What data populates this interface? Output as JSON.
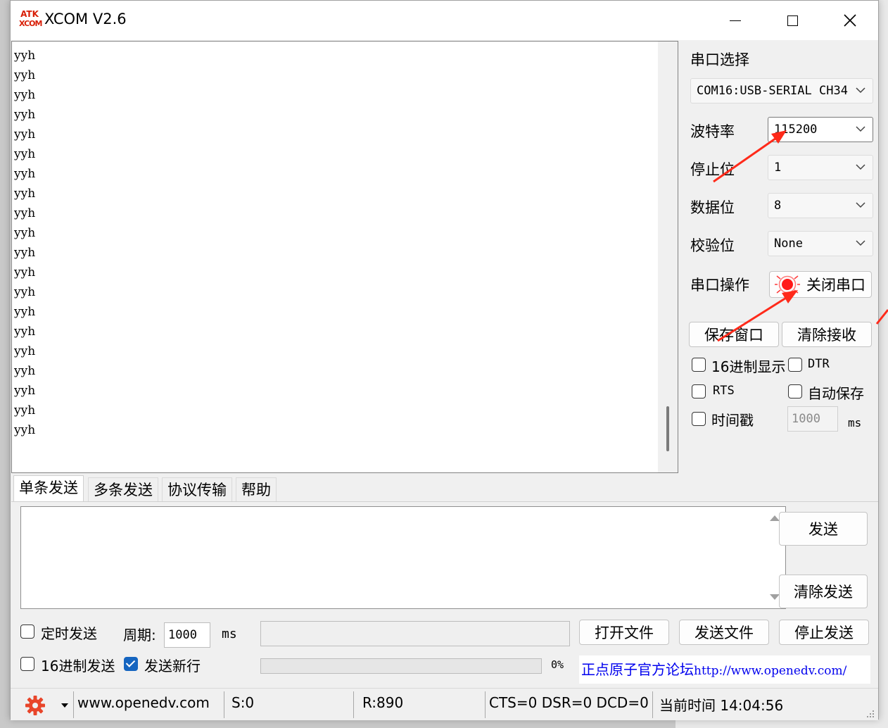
{
  "window": {
    "title": "XCOM V2.6",
    "icon_text": [
      "ATK",
      "XCOM"
    ]
  },
  "receive": {
    "lines": [
      "yyh",
      "yyh",
      "yyh",
      "yyh",
      "yyh",
      "yyh",
      "yyh",
      "yyh",
      "yyh",
      "yyh",
      "yyh",
      "yyh",
      "yyh",
      "yyh",
      "yyh",
      "yyh",
      "yyh",
      "yyh",
      "yyh",
      "yyh"
    ]
  },
  "serial": {
    "port_label": "串口选择",
    "port_value": "COM16:USB-SERIAL CH34",
    "baud_label": "波特率",
    "baud_value": "115200",
    "stop_label": "停止位",
    "stop_value": "1",
    "data_label": "数据位",
    "data_value": "8",
    "parity_label": "校验位",
    "parity_value": "None",
    "op_label": "串口操作",
    "op_button": "关闭串口",
    "save_window": "保存窗口",
    "clear_receive": "清除接收"
  },
  "options": {
    "hex_display": "16进制显示",
    "dtr": "DTR",
    "rts": "RTS",
    "auto_save": "自动保存",
    "timestamp": "时间戳",
    "timestamp_value": "1000",
    "timestamp_unit": "ms"
  },
  "tabs": [
    {
      "label": "单条发送",
      "active": true
    },
    {
      "label": "多条发送",
      "active": false
    },
    {
      "label": "协议传输",
      "active": false
    },
    {
      "label": "帮助",
      "active": false
    }
  ],
  "send": {
    "text": "",
    "send_button": "发送",
    "clear_send_button": "清除发送",
    "timed_send": "定时发送",
    "period_label": "周期:",
    "period_value": "1000",
    "period_unit": "ms",
    "open_file": "打开文件",
    "send_file": "发送文件",
    "stop_send": "停止发送",
    "hex_send": "16进制发送",
    "send_newline": "发送新行",
    "send_newline_checked": true,
    "progress_text": "0%",
    "progress": 0,
    "forum_text": "正点原子官方论坛",
    "forum_url": "http://www.openedv.com/"
  },
  "status": {
    "website": "www.openedv.com",
    "sent": "S:0",
    "received": "R:890",
    "lines": "CTS=0 DSR=0 DCD=0",
    "time": "当前时间 14:04:56"
  },
  "colors": {
    "accent_red": "#ff2a1a",
    "link_blue": "#0000ee",
    "check_blue": "#1565c0"
  }
}
